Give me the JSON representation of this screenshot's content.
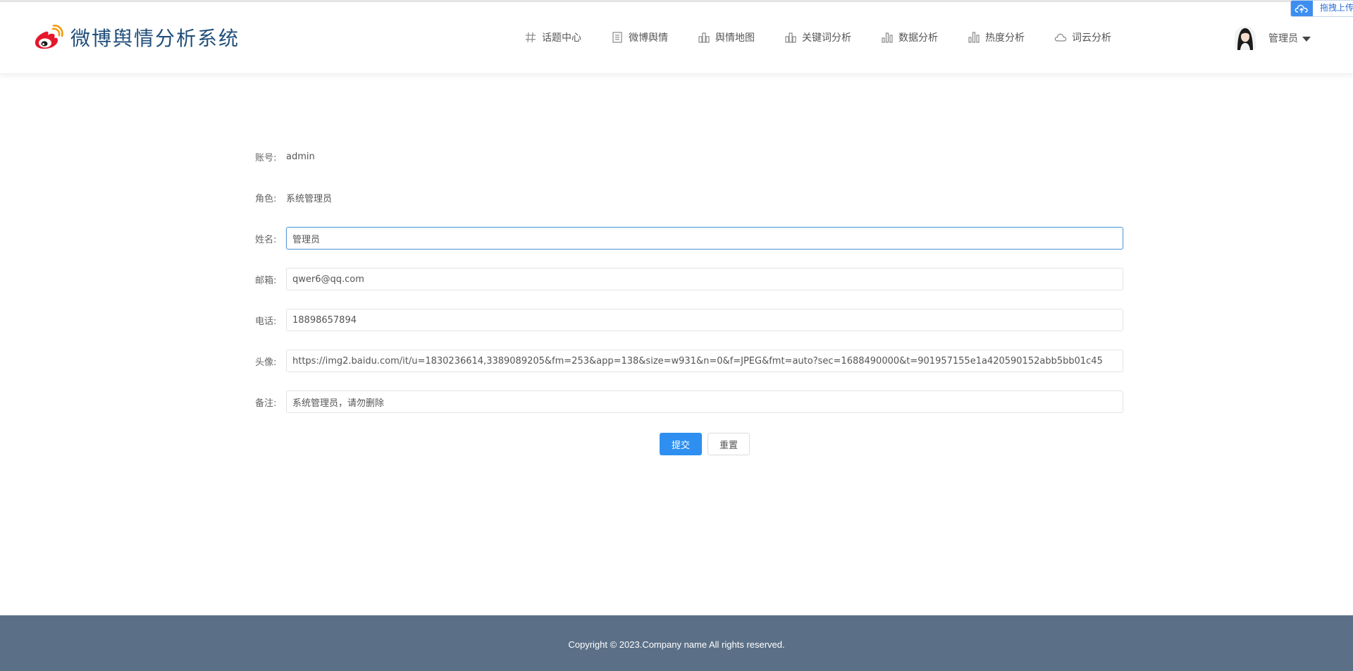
{
  "header": {
    "logo_text": "微博舆情分析系统",
    "nav": [
      {
        "label": "话题中心",
        "icon": "hash-icon"
      },
      {
        "label": "微博舆情",
        "icon": "document-icon"
      },
      {
        "label": "舆情地图",
        "icon": "map-icon"
      },
      {
        "label": "关键词分析",
        "icon": "keyword-chart-icon"
      },
      {
        "label": "数据分析",
        "icon": "bar-chart-icon"
      },
      {
        "label": "热度分析",
        "icon": "heat-chart-icon"
      },
      {
        "label": "词云分析",
        "icon": "cloud-icon"
      }
    ],
    "user": {
      "name": "管理员"
    },
    "upload_widget": {
      "label": "拖拽上传"
    }
  },
  "form": {
    "account": {
      "label": "账号:",
      "value": "admin"
    },
    "role": {
      "label": "角色:",
      "value": "系统管理员"
    },
    "name": {
      "label": "姓名:",
      "value": "管理员"
    },
    "email": {
      "label": "邮箱:",
      "value": "qwer6@qq.com"
    },
    "phone": {
      "label": "电话:",
      "value": "18898657894"
    },
    "avatar": {
      "label": "头像:",
      "value": "https://img2.baidu.com/it/u=1830236614,3389089205&fm=253&app=138&size=w931&n=0&f=JPEG&fmt=auto?sec=1688490000&t=901957155e1a420590152abb5bb01c45"
    },
    "remark": {
      "label": "备注:",
      "value": "系统管理员，请勿删除"
    },
    "submit_label": "提交",
    "reset_label": "重置"
  },
  "footer": {
    "copyright": "Copyright © 2023.Company name All rights reserved."
  },
  "colors": {
    "primary": "#2e8ff0",
    "footer_bg": "#5b7087",
    "logo_text": "#1f4e79",
    "weibo_red": "#e6162d"
  }
}
